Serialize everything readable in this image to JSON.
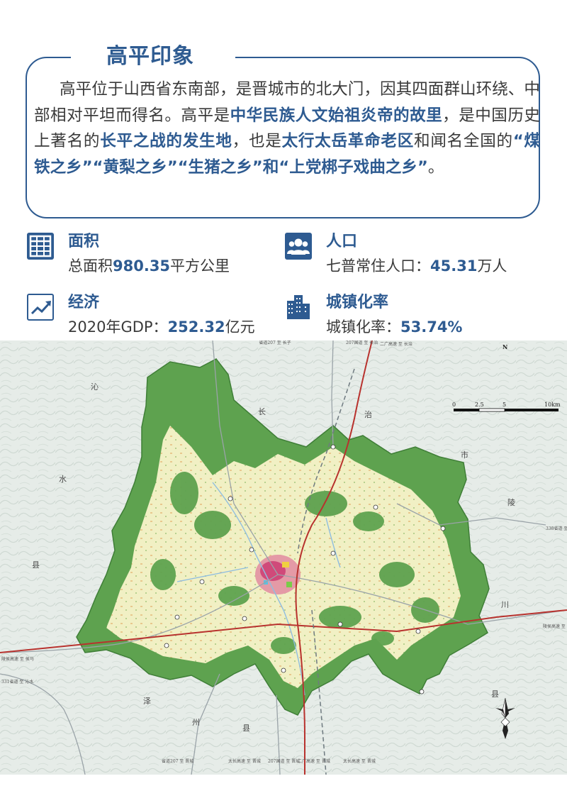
{
  "intro": {
    "title": "高平印象",
    "p1": "高平位于山西省东南部，是晋城市的北大门，因其四面群山环绕、中部相对平坦而得名。高平是",
    "h1": "中华民族人文始祖炎帝的故里",
    "p2": "，是中国历史上著名的",
    "h2": "长平之战的发生地",
    "p3": "，也是",
    "h3": "太行太岳革命老区",
    "p4": "和闻名全国的",
    "h4": "“煤铁之乡”“黄梨之乡”“生猪之乡”和“上党梆子戏曲之乡”",
    "p5": "。"
  },
  "stats": {
    "area": {
      "label": "面积",
      "prefix": "总面积",
      "value": "980.35",
      "suffix": "平方公里",
      "icon": "grid-icon"
    },
    "population": {
      "label": "人口",
      "prefix": "七普常住人口：",
      "value": "45.31",
      "suffix": "万人",
      "icon": "people-icon"
    },
    "economy": {
      "label": "经济",
      "prefix": "2020年GDP：",
      "value": "252.32",
      "suffix": "亿元",
      "icon": "trend-chart-icon"
    },
    "urbanization": {
      "label": "城镇化率",
      "prefix": "城镇化率：",
      "value": "53.74%",
      "suffix": "",
      "icon": "buildings-icon"
    }
  },
  "map": {
    "county_labels": [
      "沁",
      "水",
      "县",
      "长",
      "治",
      "市",
      "陵",
      "川",
      "县",
      "泽",
      "州",
      "县"
    ],
    "north": "N",
    "scale": {
      "t0": "0",
      "t1": "2.5",
      "t2": "5",
      "t3": "10km"
    },
    "road_labels": {
      "top1": "省道207 至 长子",
      "top2": "207国道 至 长治",
      "top3": "二广高速 至 长治",
      "right1": "338省道 至 陵川",
      "right2": "陵侯高速 至 晋城",
      "left1": "陵侯高速 至 侯马",
      "left2": "331省道 至 沁水",
      "b1": "省道207 至 晋城",
      "b2": "太长高速 至 晋城",
      "b3": "207国道 至 晋城",
      "b4": "二广高速 至 晋城",
      "b5": "太长高速 至 晋城"
    }
  },
  "colors": {
    "brand": "#2e5b91",
    "text": "#3a3a3a",
    "forest": "#5ea24f",
    "farmland": "#f1f0c4",
    "terrain": "#e4ebe6"
  }
}
